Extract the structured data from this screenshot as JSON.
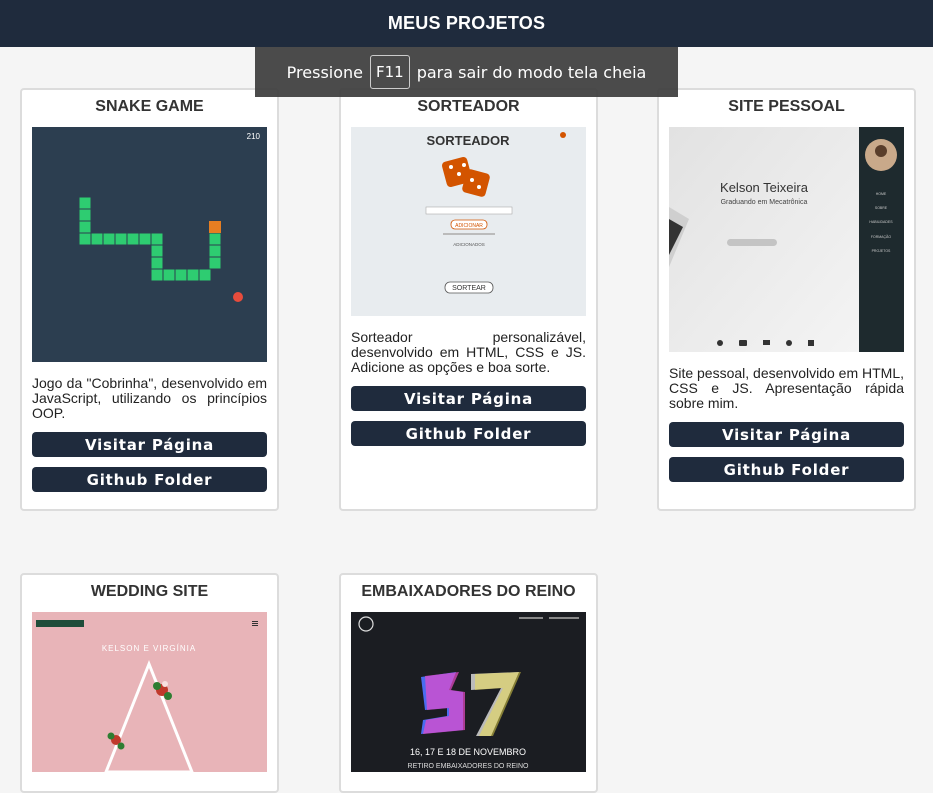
{
  "header": {
    "title": "MEUS PROJETOS"
  },
  "toast": {
    "before": "Pressione",
    "key": "F11",
    "after": "para sair do modo tela cheia"
  },
  "projects": [
    {
      "title": "SNAKE GAME",
      "description": "Jogo da \"Cobrinha\", desenvolvido em JavaScript, utilizando os princípios OOP.",
      "visit_label": "Visitar Página",
      "github_label": "Github Folder",
      "thumb": {
        "score": "210"
      }
    },
    {
      "title": "SORTEADOR",
      "description": "Sorteador personalizável, desenvolvido em HTML, CSS e JS. Adicione as opções e boa sorte.",
      "visit_label": "Visitar Página",
      "github_label": "Github Folder",
      "thumb": {
        "heading": "SORTEADOR",
        "add": "ADICIONAR",
        "added": "ADICIONADOS",
        "draw": "SORTEAR"
      }
    },
    {
      "title": "SITE PESSOAL",
      "description": "Site pessoal, desenvolvido em HTML, CSS e JS. Apresentação rápida sobre mim.",
      "visit_label": "Visitar Página",
      "github_label": "Github Folder",
      "thumb": {
        "name": "Kelson Teixeira",
        "subtitle": "Graduando em Mecatrônica",
        "menu": [
          "HOME",
          "SOBRE",
          "HABILIDADES",
          "FORMAÇÃO",
          "PROJETOS"
        ]
      }
    },
    {
      "title": "WEDDING SITE",
      "thumb": {
        "names": "KELSON E VIRGÍNIA"
      }
    },
    {
      "title": "EMBAIXADORES DO REINO",
      "thumb": {
        "dates": "16, 17 E 18 DE NOVEMBRO",
        "event": "RETIRO EMBAIXADORES DO REINO"
      }
    }
  ],
  "colors": {
    "header": "#1f2b3d",
    "button": "#1f2b3d",
    "snake": "#2ecc71",
    "snake_bg": "#2c3e50",
    "dice": "#d35400",
    "wedding_bg": "#e8b4b8"
  }
}
